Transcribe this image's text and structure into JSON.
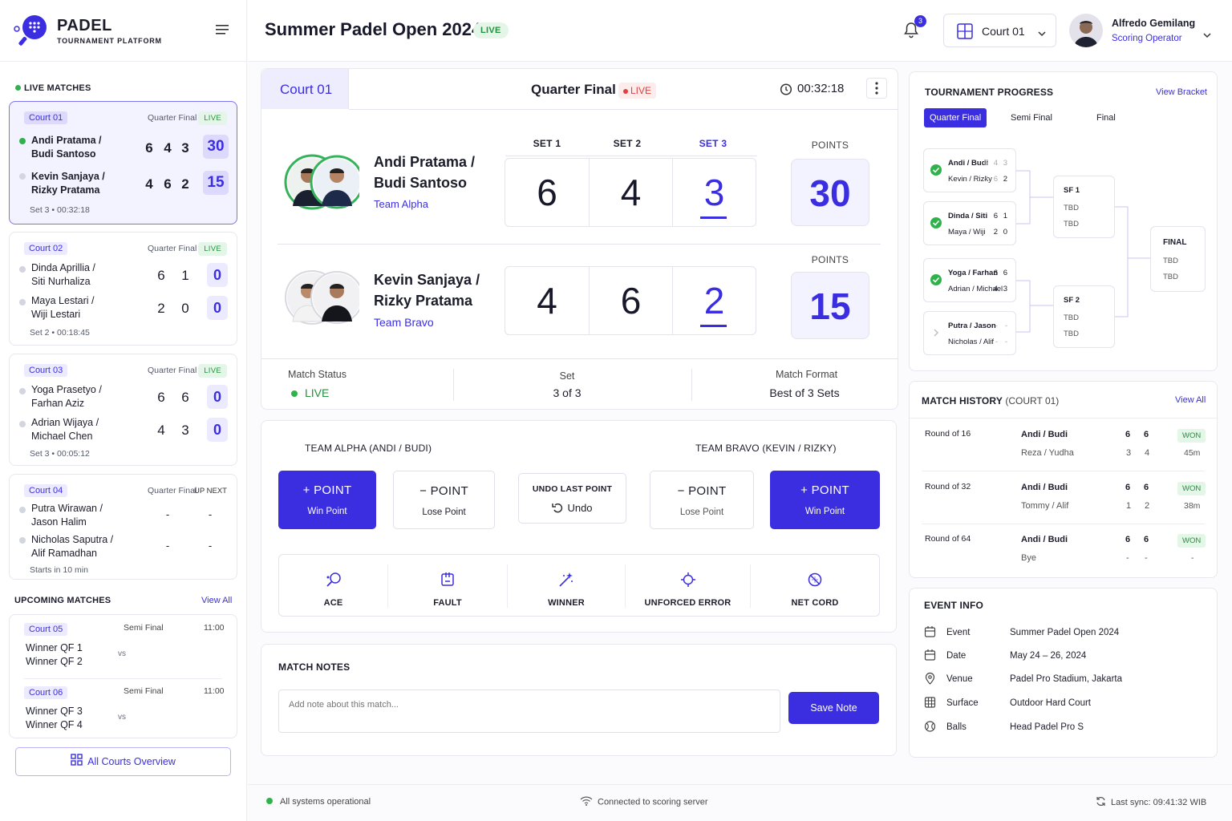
{
  "brand": {
    "name": "PADEL",
    "subtitle": "TOURNAMENT PLATFORM"
  },
  "header": {
    "title": "Summer Padel Open 2024",
    "status": "LIVE",
    "notifications": "3",
    "court_select": "Court 01",
    "user": {
      "name": "Alfredo Gemilang",
      "role": "Scoring Operator"
    }
  },
  "sidebar": {
    "live_label": "LIVE MATCHES",
    "matches": [
      {
        "court": "Court 01",
        "round": "Quarter Final",
        "status": "LIVE",
        "team1": [
          "Andi Pratama /",
          "Budi Santoso"
        ],
        "t1_sets": [
          "6",
          "4",
          "3"
        ],
        "t1_pts": "30",
        "team2": [
          "Kevin Sanjaya /",
          "Rizky Pratama"
        ],
        "t2_sets": [
          "4",
          "6",
          "2"
        ],
        "t2_pts": "15",
        "foot": "Set 3 • 00:32:18"
      },
      {
        "court": "Court 02",
        "round": "Quarter Final",
        "status": "LIVE",
        "team1": [
          "Dinda Aprillia /",
          "Siti Nurhaliza"
        ],
        "t1_sets": [
          "6",
          "1"
        ],
        "t1_pts": "0",
        "team2": [
          "Maya Lestari /",
          "Wiji Lestari"
        ],
        "t2_sets": [
          "2",
          "0"
        ],
        "t2_pts": "0",
        "foot": "Set 2 • 00:18:45"
      },
      {
        "court": "Court 03",
        "round": "Quarter Final",
        "status": "LIVE",
        "team1": [
          "Yoga Prasetyo /",
          "Farhan Aziz"
        ],
        "t1_sets": [
          "6",
          "6"
        ],
        "t1_pts": "0",
        "team2": [
          "Adrian Wijaya /",
          "Michael Chen"
        ],
        "t2_sets": [
          "4",
          "3"
        ],
        "t2_pts": "0",
        "foot": "Set 3 • 00:05:12"
      },
      {
        "court": "Court 04",
        "round": "Quarter Final",
        "status": "UP NEXT",
        "team1": [
          "Putra Wirawan /",
          "Jason Halim"
        ],
        "t1_sets": [
          "-",
          "-"
        ],
        "team2": [
          "Nicholas Saputra /",
          "Alif Ramadhan"
        ],
        "t2_sets": [
          "-",
          "-"
        ],
        "foot": "Starts in 10 min"
      }
    ],
    "upcoming_label": "UPCOMING MATCHES",
    "view_all": "View All",
    "upcoming": [
      {
        "court": "Court 05",
        "round": "Semi Final",
        "time": "11:00",
        "a": "Winner QF 1",
        "b": "Winner QF 2",
        "vs": "vs"
      },
      {
        "court": "Court 06",
        "round": "Semi Final",
        "time": "11:00",
        "a": "Winner QF 3",
        "b": "Winner QF 4",
        "vs": "vs"
      }
    ],
    "all_courts": "All Courts Overview"
  },
  "score": {
    "court": "Court 01",
    "round": "Quarter Final",
    "live": "LIVE",
    "timer": "00:32:18",
    "set_labels": [
      "SET 1",
      "SET 2",
      "SET 3"
    ],
    "points_label": "POINTS",
    "team1": {
      "line1": "Andi Pratama /",
      "line2": "Budi Santoso",
      "team": "Team Alpha",
      "sets": [
        "6",
        "4",
        "3"
      ],
      "points": "30"
    },
    "team2": {
      "line1": "Kevin Sanjaya /",
      "line2": "Rizky Pratama",
      "team": "Team Bravo",
      "sets": [
        "4",
        "6",
        "2"
      ],
      "points": "15"
    },
    "status_label": "Match Status",
    "status_value": "LIVE",
    "set_label": "Set",
    "set_value": "3 of 3",
    "format_label": "Match Format",
    "format_value": "Best of 3 Sets"
  },
  "controls": {
    "team_a": "TEAM ALPHA (ANDI / BUDI)",
    "team_b": "TEAM BRAVO (KEVIN / RIZKY)",
    "point": "POINT",
    "win_point": "Win Point",
    "lose_point": "Lose Point",
    "undo_title": "UNDO LAST POINT",
    "undo": "Undo",
    "actions": [
      "ACE",
      "FAULT",
      "WINNER",
      "UNFORCED ERROR",
      "NET CORD"
    ]
  },
  "notes": {
    "title": "MATCH NOTES",
    "placeholder": "Add note about this match...",
    "save": "Save Note"
  },
  "progress": {
    "title": "TOURNAMENT PROGRESS",
    "view": "View Bracket",
    "tabs": [
      "Quarter Final",
      "Semi Final",
      "Final"
    ],
    "qf": [
      {
        "a": "Andi / Budi",
        "as": [
          "6",
          "4",
          "3"
        ],
        "b": "Kevin / Rizky",
        "bs": [
          "4",
          "6",
          "2"
        ]
      },
      {
        "a": "Dinda / Siti",
        "as": [
          "6",
          "1"
        ],
        "b": "Maya / Wiji",
        "bs": [
          "2",
          "0"
        ]
      },
      {
        "a": "Yoga / Farhan",
        "as": [
          "6",
          "6"
        ],
        "b": "Adrian / Michael",
        "bs": [
          "4",
          "3"
        ]
      },
      {
        "a": "Putra / Jason",
        "as": [
          "-",
          "-"
        ],
        "b": "Nicholas / Alif",
        "bs": [
          "-",
          "-"
        ]
      }
    ],
    "sf": [
      {
        "label": "SF 1",
        "a": "TBD",
        "b": "TBD"
      },
      {
        "label": "SF 2",
        "a": "TBD",
        "b": "TBD"
      }
    ],
    "final": {
      "label": "FINAL",
      "a": "TBD",
      "b": "TBD"
    }
  },
  "history": {
    "title": "MATCH HISTORY",
    "court": "(COURT 01)",
    "view_all": "View All",
    "rows": [
      {
        "round": "Round of 16",
        "a": "Andi / Budi",
        "as": [
          "6",
          "6"
        ],
        "b": "Reza / Yudha",
        "bs": [
          "3",
          "4"
        ],
        "result": "WON",
        "dur": "45m"
      },
      {
        "round": "Round of 32",
        "a": "Andi / Budi",
        "as": [
          "6",
          "6"
        ],
        "b": "Tommy / Alif",
        "bs": [
          "1",
          "2"
        ],
        "result": "WON",
        "dur": "38m"
      },
      {
        "round": "Round of 64",
        "a": "Andi / Budi",
        "as": [
          "6",
          "6"
        ],
        "b": "Bye",
        "bs": [
          "-",
          "-"
        ],
        "result": "WON",
        "dur": "-"
      }
    ]
  },
  "event": {
    "title": "EVENT INFO",
    "rows": [
      {
        "label": "Event",
        "value": "Summer Padel Open 2024"
      },
      {
        "label": "Date",
        "value": "May 24 – 26, 2024"
      },
      {
        "label": "Venue",
        "value": "Padel Pro Stadium, Jakarta"
      },
      {
        "label": "Surface",
        "value": "Outdoor Hard Court"
      },
      {
        "label": "Balls",
        "value": "Head Padel Pro S"
      }
    ]
  },
  "footer": {
    "status": "All systems operational",
    "connection": "Connected to scoring server",
    "sync": "Last sync: 09:41:32 WIB"
  },
  "colors": {
    "accent": "#3b2ee0",
    "live": "#2fb24c"
  }
}
